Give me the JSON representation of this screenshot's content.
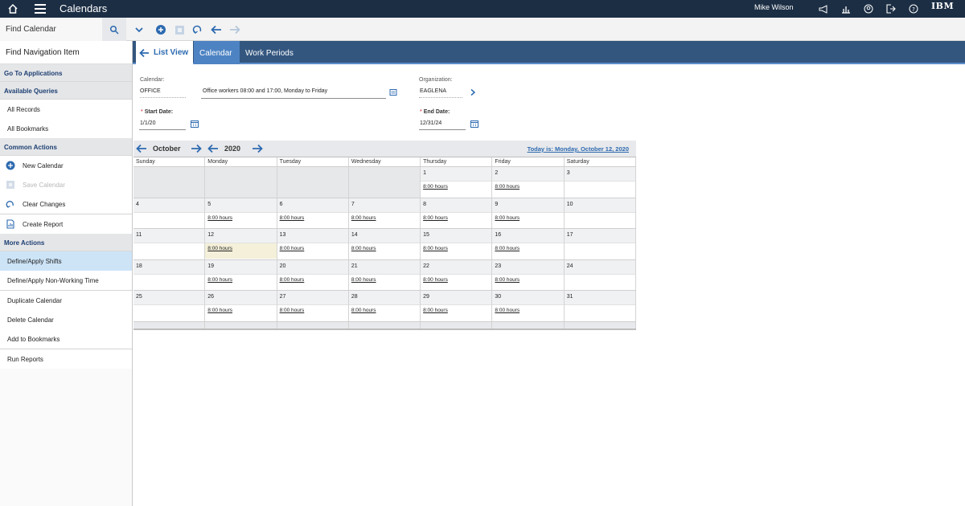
{
  "app": {
    "title": "Calendars",
    "user": "Mike Wilson",
    "brand": "IBM"
  },
  "toolbar": {
    "find_placeholder": "Find Calendar"
  },
  "sidebar": {
    "find_nav": "Find Navigation Item",
    "go_to_apps": "Go To Applications",
    "available_queries": "Available Queries",
    "queries": [
      "All Records",
      "All Bookmarks"
    ],
    "common_actions": "Common Actions",
    "common": [
      "New Calendar",
      "Save Calendar",
      "Clear Changes",
      "Create Report"
    ],
    "more_actions": "More Actions",
    "more": [
      "Define/Apply Shifts",
      "Define/Apply Non-Working Time",
      "Duplicate Calendar",
      "Delete Calendar",
      "Add to Bookmarks",
      "Run Reports"
    ]
  },
  "tabs": {
    "list_view": "List View",
    "calendar": "Calendar",
    "work_periods": "Work Periods"
  },
  "form": {
    "calendar_label": "Calendar:",
    "calendar_value": "OFFICE",
    "description": "Office workers 08:00 and 17:00, Monday to Friday",
    "org_label": "Organization:",
    "org_value": "EAGLENA",
    "req_mark": "*",
    "start_label": "Start Date:",
    "start_value": "1/1/20",
    "end_label": "End Date:",
    "end_value": "12/31/24"
  },
  "calendar": {
    "month": "October",
    "year": "2020",
    "today_text": "Today is: Monday, October 12, 2020",
    "weekdays": [
      "Sunday",
      "Monday",
      "Tuesday",
      "Wednesday",
      "Thursday",
      "Friday",
      "Saturday"
    ],
    "hours_label": "8:00 hours",
    "weeks": [
      [
        null,
        null,
        null,
        null,
        "1",
        "2",
        "3"
      ],
      [
        "4",
        "5",
        "6",
        "7",
        "8",
        "9",
        "10"
      ],
      [
        "11",
        "12",
        "13",
        "14",
        "15",
        "16",
        "17"
      ],
      [
        "18",
        "19",
        "20",
        "21",
        "22",
        "23",
        "24"
      ],
      [
        "25",
        "26",
        "27",
        "28",
        "29",
        "30",
        "31"
      ]
    ]
  }
}
